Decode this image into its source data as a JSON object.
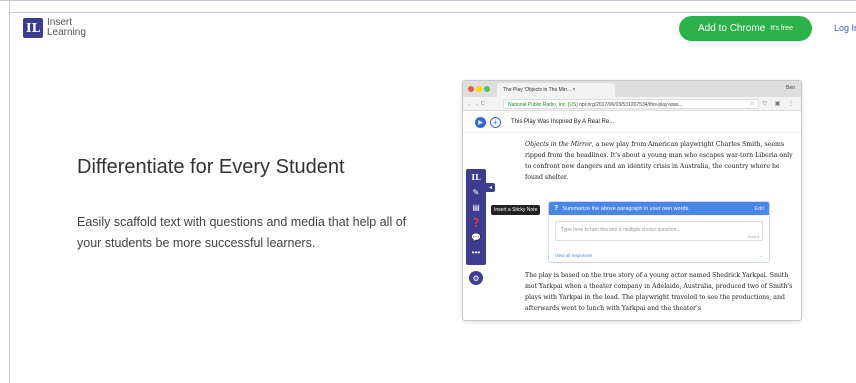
{
  "header": {
    "logo_mark": "IL",
    "logo_line1": "Insert",
    "logo_line2": "Learning",
    "add_to_chrome": "Add to Chrome",
    "free_label": "It's free",
    "login": "Log In"
  },
  "hero": {
    "title": "Differentiate for Every Student",
    "subtitle": "Easily scaffold text with questions and media that help all of your students be more successful learners."
  },
  "browser": {
    "tab_title": "The Play 'Objects in The Mirr...",
    "tab_close": "×",
    "user": "Ben",
    "nav": "←→C",
    "secure_label": "National Public Radio, Inc. [US]",
    "url": "npr.org/2017/06/03/531207534/this-play-was...",
    "ext_icons": "☆ ▽ ▣ ⋮",
    "colors": {
      "dot_red": "#ed594a",
      "dot_yellow": "#fdd800",
      "dot_green": "#5ac05a"
    }
  },
  "player": {
    "play_icon": "▶",
    "plus_icon": "+",
    "title": "This Play Was Inspired By A Real Re..."
  },
  "article": {
    "para1_italic": "Objects in the Mirror",
    "para1_rest": ", a new play from American playwright Charles Smith, seems ripped from the headlines. It's about a young man who escapes war-torn Liberia only to confront new dangers and an identity crisis in Australia, the country where he found shelter.",
    "para2": "The play is based on the true story of a young actor named Shedrick Yarkpai. Smith met Yarkpai when a theater company in Adelaide, Australia, produced two of Smith's plays with Yarkpai in the lead. The playwright traveled to see the productions, and afterwards went to lunch with Yarkpai and the theater's"
  },
  "toolbar": {
    "logo": "IL",
    "tools": [
      "✎",
      "▤",
      "❓",
      "💬",
      "•••"
    ],
    "collapse": "◂",
    "settings": "⚙",
    "tooltip": "Insert a Sticky Note"
  },
  "question": {
    "qmark": "?",
    "prompt": "Summarize the above paragraph in your own words.",
    "edit": "Edit",
    "placeholder": "Type here to turn this into a multiple choice question...",
    "saved": "Saved",
    "view_responses": "View all responses",
    "arrow": "→"
  }
}
